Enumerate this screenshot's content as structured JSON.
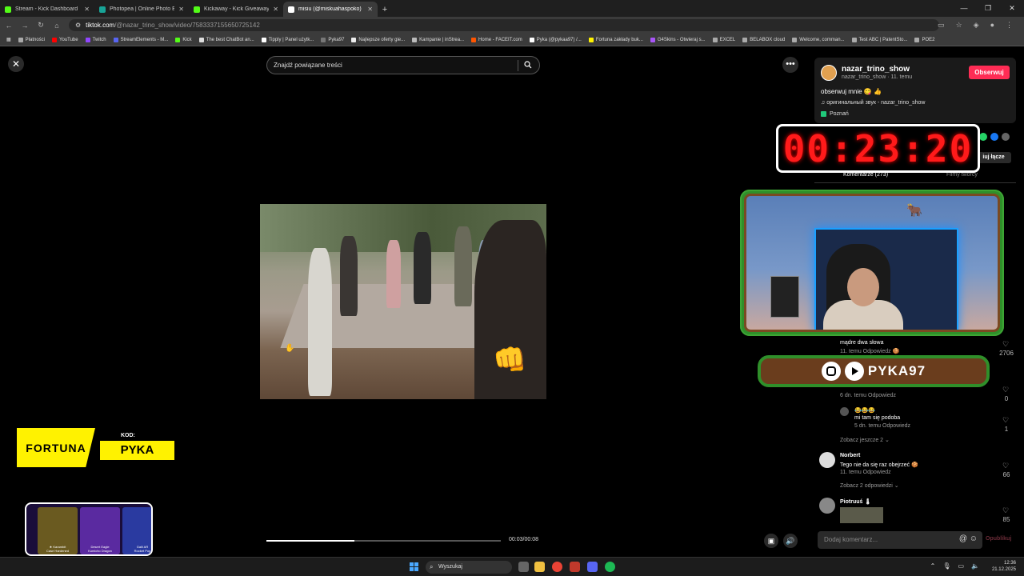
{
  "tabs": [
    {
      "title": "Stream - Kick Dashboard",
      "color": "#53fc18"
    },
    {
      "title": "Photopea | Online Photo Editor",
      "color": "#18a497"
    },
    {
      "title": "Kickaway - Kick Giveaway Tool",
      "color": "#53fc18"
    },
    {
      "title": "misiu (@miskuahaspoko) | T",
      "color": "#ffffff"
    }
  ],
  "address": {
    "host": "tiktok.com",
    "path": "/@nazar_trino_show/video/7583337155650725142"
  },
  "bookmarks": [
    "Płatności",
    "YouTube",
    "Twitch",
    "StreamElements - M...",
    "Kick",
    "The best ChatBot an...",
    "Tipply | Panel użytk...",
    "Pyka97",
    "Najlepsze oferty gie...",
    "Kampanie | inStrea...",
    "Home - FACEIT.com",
    "Pyka (@pykaa97) /...",
    "Fortuna zakłady buk...",
    "G4Skins - Otwieraj s...",
    "EXCEL",
    "BELABOX cloud",
    "Welcome, comman...",
    "Test ABC | PatentSto...",
    "POE2"
  ],
  "video": {
    "search_placeholder": "Znajdź powiązane treści",
    "time": "00:03/00:08",
    "progress": 0.375
  },
  "author": {
    "name": "nazar_trino_show",
    "sub": "nazar_trino_show · 11. temu",
    "follow": "Obserwuj",
    "description": "obserwuj mnie 😋 👍",
    "sound": "♫  оригинальный звук - nazar_trino_show",
    "place": "Poznań"
  },
  "panel": {
    "copy_link": "iuj łącze",
    "tab_comments": "Komentarze (273)",
    "tab_creator": "Filmy twórcy"
  },
  "overlay": {
    "timer": "00:23:20",
    "banner_name": "PYKA97",
    "fortuna_brand": "FORTUNA",
    "fortuna_kod": "KOD:",
    "fortuna_code": "PYKA",
    "case_items": [
      {
        "name": "★ Karambit",
        "sub": "Case Hardened"
      },
      {
        "name": "Desert Eagle",
        "sub": "Kumicho Dragon"
      },
      {
        "name": "Galil AR",
        "sub": "Rocket Pop"
      }
    ]
  },
  "comments": {
    "c1_text": "mądre dwa słowa",
    "c1_meta": "11. temu    Odpowiedz 🍪",
    "c1_likes": "2706",
    "c2_meta": "6 dn. temu    Odpowiedz",
    "c2_likes": "0",
    "r1_emoji": "😂😂😂",
    "r1_text": "mi tam się podoba",
    "r1_meta": "5 dn. temu    Odpowiedz",
    "r1_likes": "1",
    "r1_more": "Zobacz jeszcze 2  ⌄",
    "c3_name": "Norbert",
    "c3_text": "Tego nie da się raz obejrzeć 🍪",
    "c3_meta": "11. temu    Odpowiedz",
    "c3_likes": "66",
    "c3_more": "Zobacz 2 odpowiedzi  ⌄",
    "c4_name": "Piotruuś 🌡",
    "c4_likes": "85",
    "input_placeholder": "Dodaj komentarz...",
    "post": "Opublikuj"
  },
  "taskbar": {
    "search": "Wyszukaj",
    "time": "12:36",
    "date": "21.12.2025"
  }
}
